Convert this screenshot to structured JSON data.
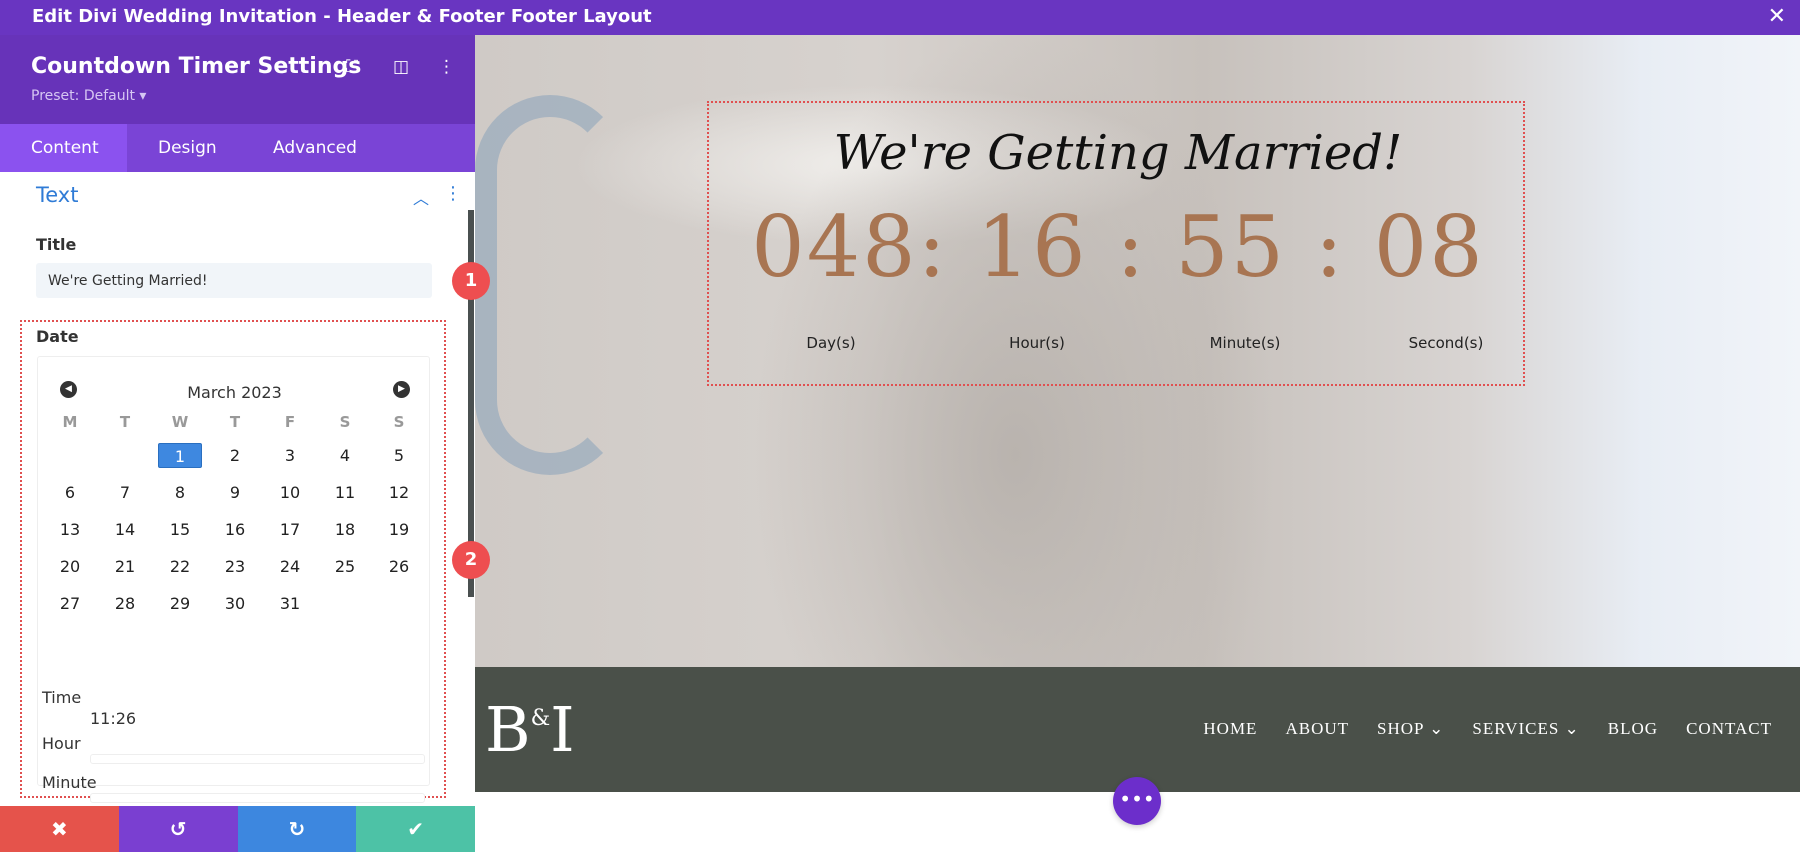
{
  "window": {
    "title": "Edit Divi Wedding Invitation - Header & Footer Footer Layout",
    "close_icon": "close-icon"
  },
  "panel": {
    "title": "Countdown Timer Settings",
    "preset": "Preset: Default ▾",
    "tabs": [
      {
        "label": "Content"
      },
      {
        "label": "Design"
      },
      {
        "label": "Advanced"
      }
    ],
    "section": "Text",
    "title_label": "Title",
    "title_value": "We're Getting Married!",
    "date_label": "Date",
    "calendar": {
      "month": "March 2023",
      "weekdays": [
        "M",
        "T",
        "W",
        "T",
        "F",
        "S",
        "S"
      ],
      "days": [
        "1",
        "2",
        "3",
        "4",
        "5",
        "6",
        "7",
        "8",
        "9",
        "10",
        "11",
        "12",
        "13",
        "14",
        "15",
        "16",
        "17",
        "18",
        "19",
        "20",
        "21",
        "22",
        "23",
        "24",
        "25",
        "26",
        "27",
        "28",
        "29",
        "30",
        "31"
      ],
      "selected": "1"
    },
    "time_label": "Time",
    "time_value": "11:26",
    "hour_label": "Hour",
    "minute_label": "Minute",
    "markers": [
      "1",
      "2"
    ]
  },
  "countdown": {
    "title": "We're Getting Married!",
    "display": "048: 16 : 55 : 08",
    "labels": [
      "Day(s)",
      "Hour(s)",
      "Minute(s)",
      "Second(s)"
    ],
    "color": "#a87552"
  },
  "footer": {
    "logo": "B&I",
    "menu": [
      "HOME",
      "ABOUT",
      "SHOP",
      "SERVICES",
      "BLOG",
      "CONTACT"
    ]
  },
  "colors": {
    "purple": "#6733b9",
    "cancel": "#e5534b",
    "undo": "#7a3fd1",
    "redo": "#3d87df",
    "save": "#4dc2a6"
  }
}
